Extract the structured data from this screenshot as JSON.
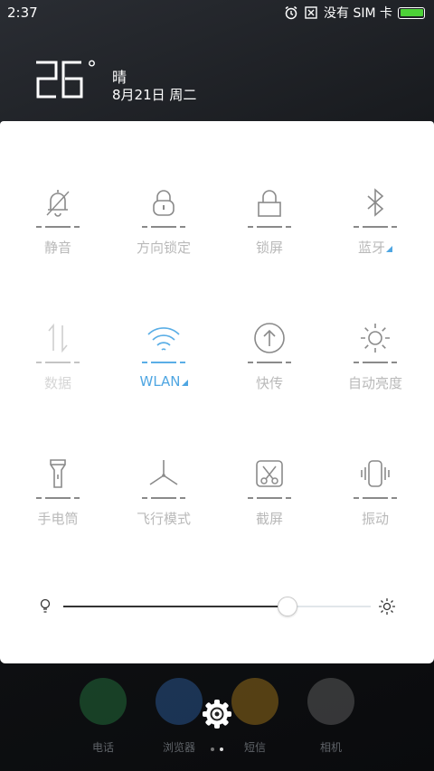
{
  "status_bar": {
    "time": "2:37",
    "carrier": "没有 SIM 卡",
    "battery_color": "#4cd137"
  },
  "weather": {
    "temperature": "26",
    "degree_symbol": "°",
    "condition": "晴",
    "date": "8月21日 周二"
  },
  "toggles": [
    {
      "label": "静音",
      "icon": "bell-icon",
      "active": false
    },
    {
      "label": "方向锁定",
      "icon": "rotation-lock-icon",
      "active": false
    },
    {
      "label": "锁屏",
      "icon": "lock-icon",
      "active": false
    },
    {
      "label": "蓝牙",
      "icon": "bluetooth-icon",
      "active": false,
      "has_expand": true
    },
    {
      "label": "数据",
      "icon": "data-icon",
      "active": false,
      "disabled": true
    },
    {
      "label": "WLAN",
      "icon": "wifi-icon",
      "active": true,
      "has_expand": true
    },
    {
      "label": "快传",
      "icon": "share-icon",
      "active": false
    },
    {
      "label": "自动亮度",
      "icon": "auto-brightness-icon",
      "active": false
    },
    {
      "label": "手电筒",
      "icon": "flashlight-icon",
      "active": false
    },
    {
      "label": "飞行模式",
      "icon": "airplane-icon",
      "active": false
    },
    {
      "label": "截屏",
      "icon": "screenshot-icon",
      "active": false
    },
    {
      "label": "振动",
      "icon": "vibrate-icon",
      "active": false
    }
  ],
  "brightness": {
    "level": 0.73
  },
  "dock": [
    {
      "label": "电话",
      "icon": "phone-icon",
      "color": "#2e9e4f"
    },
    {
      "label": "浏览器",
      "icon": "browser-icon",
      "color": "#3a7bd5"
    },
    {
      "label": "短信",
      "icon": "message-icon",
      "color": "#e0a020"
    },
    {
      "label": "相机",
      "icon": "camera-icon",
      "color": "#888888"
    }
  ],
  "colors": {
    "accent": "#4fa6e2",
    "inactive_label": "#b9b9b9",
    "panel_bg": "#ffffff"
  }
}
